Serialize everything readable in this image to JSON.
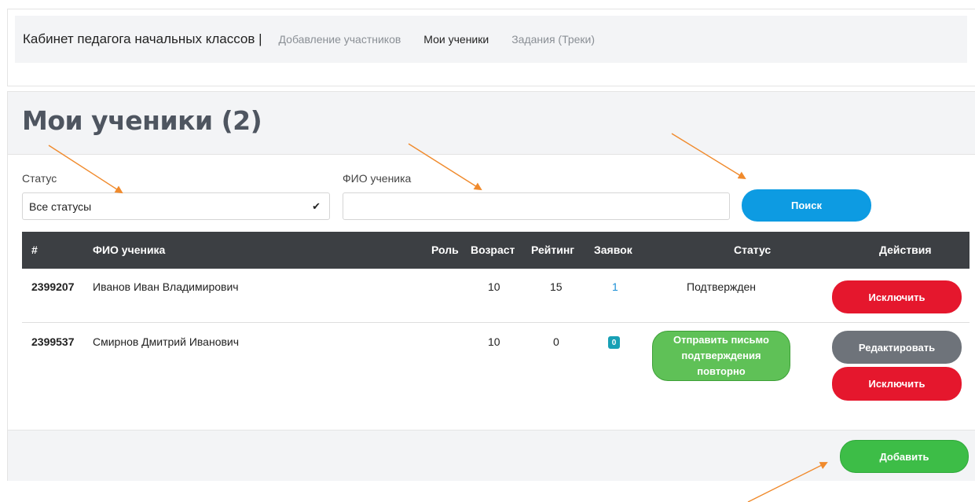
{
  "nav": {
    "brand": "Кабинет педагога начальных классов |",
    "links": [
      "Добавление участников",
      "Мои ученики",
      "Задания (Треки)"
    ],
    "active_index": 1
  },
  "page": {
    "title": "Мои ученики (2)"
  },
  "filters": {
    "status_label": "Статус",
    "status_value": "Все статусы",
    "name_label": "ФИО ученика",
    "name_value": "",
    "search_button": "Поиск"
  },
  "table": {
    "columns": [
      "#",
      "ФИО ученика",
      "Роль",
      "Возраст",
      "Рейтинг",
      "Заявок",
      "Статус",
      "Действия"
    ],
    "rows": [
      {
        "id": "2399207",
        "name": "Иванов Иван Владимирович",
        "role": "",
        "age": "10",
        "rating": "15",
        "requests": "1",
        "status": "Подтвержден",
        "actions": [
          "Исключить"
        ]
      },
      {
        "id": "2399537",
        "name": "Смирнов Дмитрий Иванович",
        "role": "",
        "age": "10",
        "rating": "0",
        "requests": "0",
        "status_button": "Отправить письмо подтверждения повторно",
        "actions": [
          "Редактировать",
          "Исключить"
        ]
      }
    ]
  },
  "footer": {
    "add_button": "Добавить"
  },
  "colors": {
    "primary": "#0d9be2",
    "danger": "#e5172d",
    "success": "#3dbd47",
    "secondary": "#6e737a",
    "table_header": "#3c3f43",
    "annotation_arrow": "#f08a2c"
  }
}
